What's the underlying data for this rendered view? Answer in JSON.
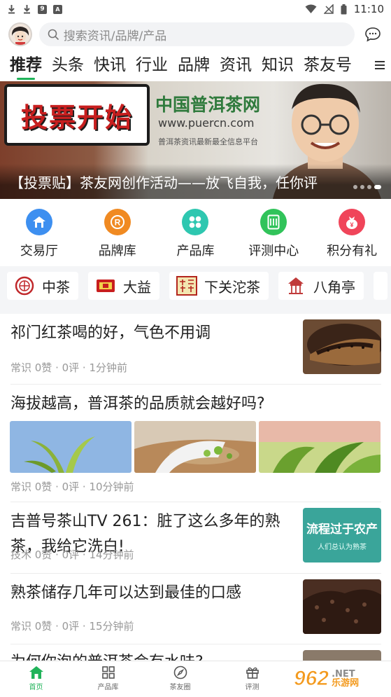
{
  "status_bar": {
    "time": "11:10",
    "left_icons": [
      "download-icon",
      "download-icon",
      "app-icon",
      "a-icon"
    ],
    "right_icons": [
      "wifi-icon",
      "signal-off-icon",
      "battery-icon"
    ]
  },
  "header": {
    "search_placeholder": "搜索资讯/品牌/产品"
  },
  "tabs": {
    "items": [
      "推荐",
      "头条",
      "快讯",
      "行业",
      "品牌",
      "资讯",
      "知识",
      "茶友号"
    ],
    "active": "推荐"
  },
  "banner": {
    "bubble_text": "投票开始",
    "logo_text": "中国普洱茶网",
    "url_text": "www.puercn.com",
    "sub_text": "普洱茶资讯最新最全信息平台",
    "caption": "【投票贴】茶友网创作活动——放飞自我，任你评",
    "slide_count": 4
  },
  "quick_nav": [
    {
      "label": "交易厅",
      "icon": "home-icon",
      "color": "#3d8ff0"
    },
    {
      "label": "品牌库",
      "icon": "brand-r-icon",
      "color": "#f08a22"
    },
    {
      "label": "产品库",
      "icon": "grid-icon",
      "color": "#2ec7b0"
    },
    {
      "label": "评测中心",
      "icon": "document-icon",
      "color": "#31c35a"
    },
    {
      "label": "积分有礼",
      "icon": "bag-icon",
      "color": "#f0455a"
    }
  ],
  "brands": [
    {
      "name": "中茶",
      "mark": "中茶"
    },
    {
      "name": "大益",
      "mark": "益"
    },
    {
      "name": "下关沱茶",
      "mark": "下关沱茶"
    },
    {
      "name": "八角亭",
      "mark": "八角亭"
    }
  ],
  "articles": [
    {
      "title": "祁门红茶喝的好，气色不用调",
      "meta": "常识 0赞 · 0评 · 1分钟前",
      "layout": "thumb"
    },
    {
      "title": "海拔越高，普洱茶的品质就会越好吗?",
      "meta": "常识 0赞 · 0评 · 10分钟前",
      "layout": "triple"
    },
    {
      "title": "吉普号茶山TV 261：脏了这么多年的熟茶，我给它洗白!",
      "meta": "技术 0赞 · 0评 · 14分钟前",
      "layout": "thumb",
      "thumb_text": "流程过于农产",
      "thumb_sub": "人们总认为熟茶"
    },
    {
      "title": "熟茶储存几年可以达到最佳的口感",
      "meta": "常识 0赞 · 0评 · 15分钟前",
      "layout": "thumb"
    },
    {
      "title": "为何你泡的普洱茶会有水味?",
      "meta": "",
      "layout": "thumb"
    }
  ],
  "bottom_nav": [
    {
      "label": "首页",
      "icon": "home-icon",
      "active": true
    },
    {
      "label": "产品库",
      "icon": "grid-icon",
      "active": false
    },
    {
      "label": "茶友圈",
      "icon": "compass-icon",
      "active": false
    },
    {
      "label": "评测",
      "icon": "gift-icon",
      "active": false
    }
  ],
  "watermark": {
    "text": "962",
    "sub": "乐游网",
    "suffix": ".NET"
  },
  "colors": {
    "accent": "#20b45a",
    "meta_gray": "#999999"
  }
}
